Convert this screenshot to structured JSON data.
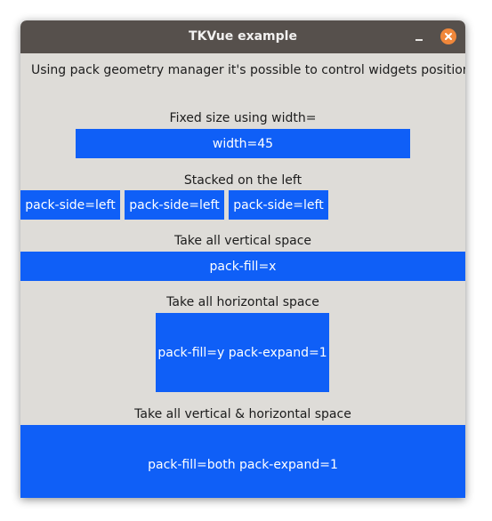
{
  "window": {
    "title": "TKVue example"
  },
  "intro_text": "Using pack geometry manager it's possible to control widgets position ar",
  "sections": {
    "fixed": {
      "label": "Fixed size using width=",
      "button": "width=45"
    },
    "stacked": {
      "label": "Stacked on the left",
      "buttons": [
        "pack-side=left",
        "pack-side=left",
        "pack-side=left"
      ]
    },
    "vertical": {
      "label": "Take all vertical space",
      "button": "pack-fill=x"
    },
    "horizontal": {
      "label": "Take all horizontal space",
      "button": "pack-fill=y pack-expand=1"
    },
    "both": {
      "label": "Take all vertical & horizontal space",
      "button": "pack-fill=both pack-expand=1"
    }
  },
  "colors": {
    "titlebar": "#56504c",
    "window_bg": "#dedcd8",
    "button_bg": "#0f5ff7",
    "button_text": "#ffffff",
    "close_button": "#f0873a"
  },
  "icons": {
    "minimize": "minimize-icon",
    "close": "close-icon"
  }
}
